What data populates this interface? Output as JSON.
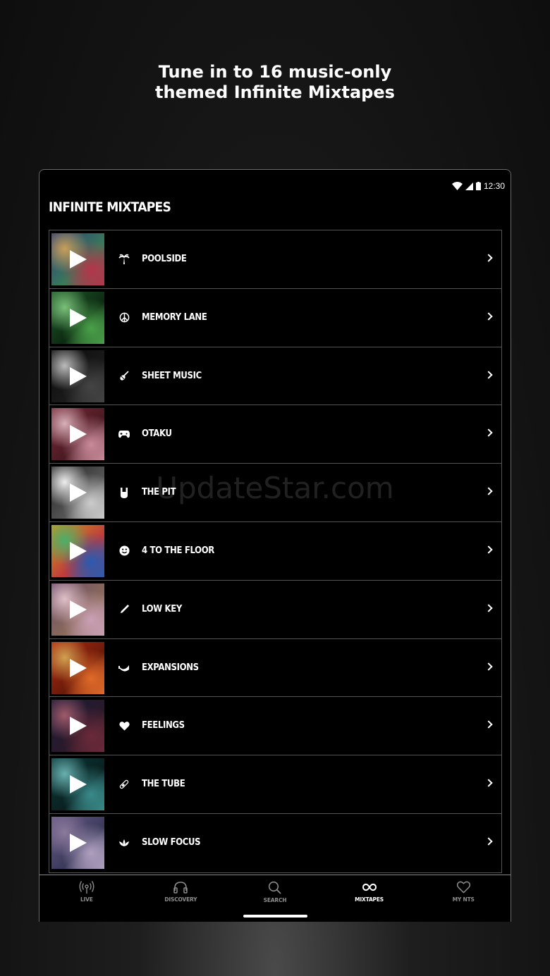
{
  "promo": {
    "line1": "Tune in to 16 music-only",
    "line2": "themed Infinite Mixtapes"
  },
  "status": {
    "time": "12:30"
  },
  "page_title": "INFINITE MIXTAPES",
  "mixtapes": [
    {
      "label": "POOLSIDE",
      "icon": "palm-tree-icon",
      "colors": [
        "#2a3b7a",
        "#b5354a",
        "#3a7a5a",
        "#c9a05a"
      ]
    },
    {
      "label": "MEMORY LANE",
      "icon": "peace-icon",
      "colors": [
        "#1f5a2a",
        "#4aa04a",
        "#0d2a12",
        "#7ac07a"
      ]
    },
    {
      "label": "SHEET MUSIC",
      "icon": "violin-icon",
      "colors": [
        "#0a0a0a",
        "#444444",
        "#1a1a1a",
        "#bbbbbb"
      ]
    },
    {
      "label": "OTAKU",
      "icon": "gamepad-icon",
      "colors": [
        "#7a2a3a",
        "#c98a9a",
        "#4a1a22",
        "#d7b0b8"
      ]
    },
    {
      "label": "THE PIT",
      "icon": "rock-hand-icon",
      "colors": [
        "#222222",
        "#cccccc",
        "#555555",
        "#eeeeee"
      ]
    },
    {
      "label": "4 TO THE FLOOR",
      "icon": "smiley-icon",
      "colors": [
        "#c9a020",
        "#2a5ab0",
        "#c03a3a",
        "#4ab06a"
      ]
    },
    {
      "label": "LOW KEY",
      "icon": "pen-icon",
      "colors": [
        "#6a4a6a",
        "#c9a0b5",
        "#8a6a5a",
        "#e0c0c8"
      ]
    },
    {
      "label": "EXPANSIONS",
      "icon": "trumpet-icon",
      "colors": [
        "#b02a10",
        "#e06a2a",
        "#6a1a0a",
        "#d0a050"
      ]
    },
    {
      "label": "FEELINGS",
      "icon": "heart-icon",
      "colors": [
        "#1a1a3a",
        "#6a2a3a",
        "#2a1a2a",
        "#a05a6a"
      ]
    },
    {
      "label": "THE TUBE",
      "icon": "pill-icon",
      "colors": [
        "#0a3a3a",
        "#3a8a8a",
        "#0a2020",
        "#6ab0b0"
      ]
    },
    {
      "label": "SLOW FOCUS",
      "icon": "lotus-icon",
      "colors": [
        "#6a5a8a",
        "#b0a0c0",
        "#3a3a5a",
        "#8a7a9a"
      ]
    }
  ],
  "watermark": "UpdateStar.com",
  "nav": [
    {
      "label": "LIVE",
      "icon": "broadcast-icon"
    },
    {
      "label": "DISCOVERY",
      "icon": "headphones-icon"
    },
    {
      "label": "SEARCH",
      "icon": "search-icon"
    },
    {
      "label": "MIXTAPES",
      "icon": "infinity-icon",
      "active": true
    },
    {
      "label": "MY NTS",
      "icon": "heart-outline-icon"
    }
  ]
}
